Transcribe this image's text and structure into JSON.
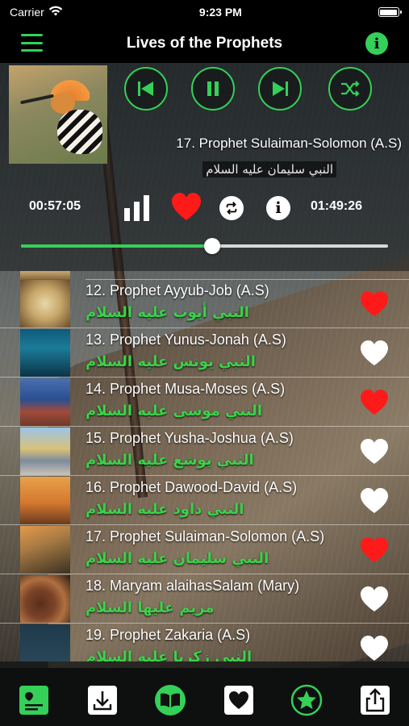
{
  "status": {
    "carrier": "Carrier",
    "time": "9:23 PM"
  },
  "nav": {
    "title": "Lives of the Prophets"
  },
  "player": {
    "now_title": "17. Prophet Sulaiman-Solomon (A.S)",
    "now_arabic": "النبي سليمان عليه السلام",
    "elapsed": "00:57:05",
    "total": "01:49:26",
    "progress": 0.52,
    "is_favorite": true
  },
  "tracks": [
    {
      "title": "12. Prophet Ayyub-Job (A.S)",
      "arabic": "النبي أيوب عليه السلام",
      "favorite": true,
      "thumb": "scroll"
    },
    {
      "title": "13. Prophet Yunus-Jonah (A.S)",
      "arabic": "النبي يونس عليه السلام",
      "favorite": false,
      "thumb": "ocean"
    },
    {
      "title": "14. Prophet Musa-Moses (A.S)",
      "arabic": "النبي موسى عليه السلام",
      "favorite": true,
      "thumb": "sea-split"
    },
    {
      "title": "15. Prophet Yusha-Joshua (A.S)",
      "arabic": "النبي يوشع عليه السلام",
      "favorite": false,
      "thumb": "dome"
    },
    {
      "title": "16. Prophet Dawood-David (A.S)",
      "arabic": "النبي داود عليه السلام",
      "favorite": false,
      "thumb": "battle"
    },
    {
      "title": "17. Prophet Sulaiman-Solomon (A.S)",
      "arabic": "النبي سليمان عليه السلام",
      "favorite": true,
      "thumb": "hoopoe"
    },
    {
      "title": "18. Maryam alaihasSalam (Mary)",
      "arabic": "مريم عليها السلام",
      "favorite": false,
      "thumb": "dates"
    },
    {
      "title": "19. Prophet Zakaria (A.S)",
      "arabic": "النبي زكريا عليه السلام",
      "favorite": false,
      "thumb": "quote"
    }
  ],
  "colors": {
    "accent": "#34d058",
    "heart": "#ff1a1a",
    "arabic_text": "#3bd24a"
  },
  "tabs": [
    "playlist-icon",
    "download-icon",
    "book-icon",
    "favorites-icon",
    "star-icon",
    "share-icon"
  ]
}
